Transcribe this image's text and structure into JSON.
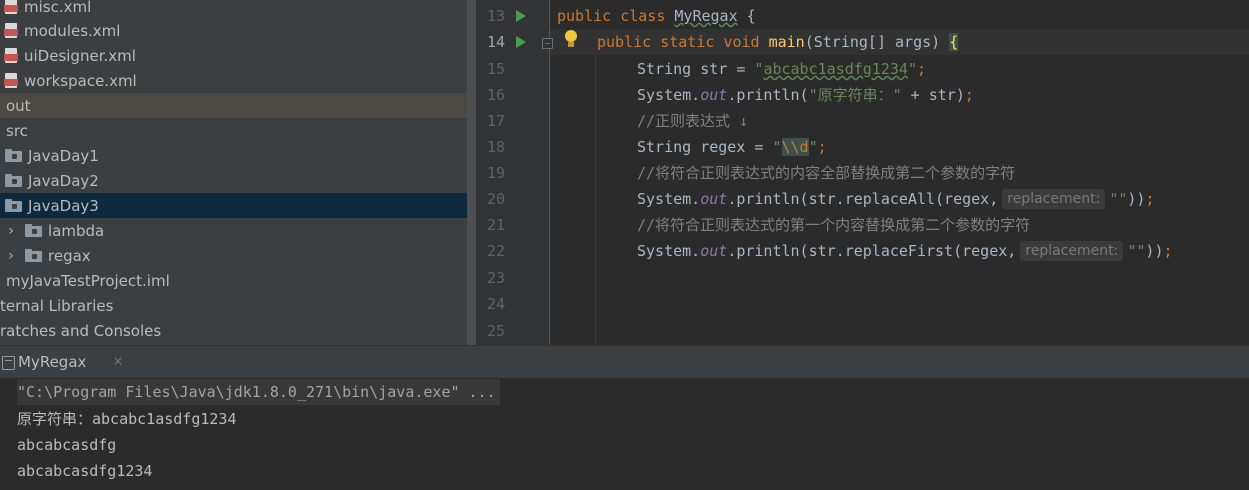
{
  "project_tree": {
    "items": [
      {
        "label": "misc.xml"
      },
      {
        "label": "modules.xml"
      },
      {
        "label": "uiDesigner.xml"
      },
      {
        "label": "workspace.xml"
      },
      {
        "label": "out"
      },
      {
        "label": "src"
      },
      {
        "label": "JavaDay1"
      },
      {
        "label": "JavaDay2"
      },
      {
        "label": "JavaDay3"
      },
      {
        "label": "lambda"
      },
      {
        "label": "regax"
      },
      {
        "label": "myJavaTestProject.iml"
      },
      {
        "label": "ternal Libraries"
      },
      {
        "label": "ratches and Consoles"
      }
    ]
  },
  "editor": {
    "line_numbers": [
      "13",
      "14",
      "15",
      "16",
      "17",
      "18",
      "19",
      "20",
      "21",
      "22",
      "23",
      "24",
      "25"
    ],
    "code": {
      "l13": {
        "kw1": "public",
        "kw2": "class",
        "name": "MyRegax",
        "brace": "{"
      },
      "l14": {
        "kw1": "public",
        "kw2": "static",
        "kw3": "void",
        "fn": "main",
        "params": "(String[] args)",
        "brace": "{"
      },
      "l15": {
        "pre": "String str = ",
        "q1": "\"",
        "strval": "abcabc1asdfg1234",
        "q2": "\"",
        "semi": ";"
      },
      "l16": {
        "pre": "System.",
        "out": "out",
        "mid": ".println(",
        "str": "\"原字符串：\"",
        "post": " + str)",
        "semi": ";"
      },
      "l17": {
        "comment": "//正则表达式 ↓"
      },
      "l18": {
        "pre": "String regex = ",
        "q1": "\"",
        "esc": "\\\\d",
        "q2": "\"",
        "semi": ";"
      },
      "l19": {
        "comment": "//将符合正则表达式的内容全部替换成第二个参数的字符"
      },
      "l20": {
        "pre": "System.",
        "out": "out",
        "mid": ".println(str.replaceAll(regex,",
        "hint": "replacement:",
        "str": "\"\"",
        "post": "))",
        "semi": ";"
      },
      "l21": {
        "comment": "//将符合正则表达式的第一个内容替换成第二个参数的字符"
      },
      "l22": {
        "pre": "System.",
        "out": "out",
        "mid": ".println(str.replaceFirst(regex,",
        "hint": "replacement:",
        "str": "\"\"",
        "post": "))",
        "semi": ";"
      }
    }
  },
  "run_panel": {
    "tab_label": "MyRegax",
    "close_glyph": "×",
    "console_lines": [
      "\"C:\\Program Files\\Java\\jdk1.8.0_271\\bin\\java.exe\" ...",
      "原字符串：abcabc1asdfg1234",
      "abcabcasdfg",
      "abcabcasdfg1234"
    ]
  }
}
